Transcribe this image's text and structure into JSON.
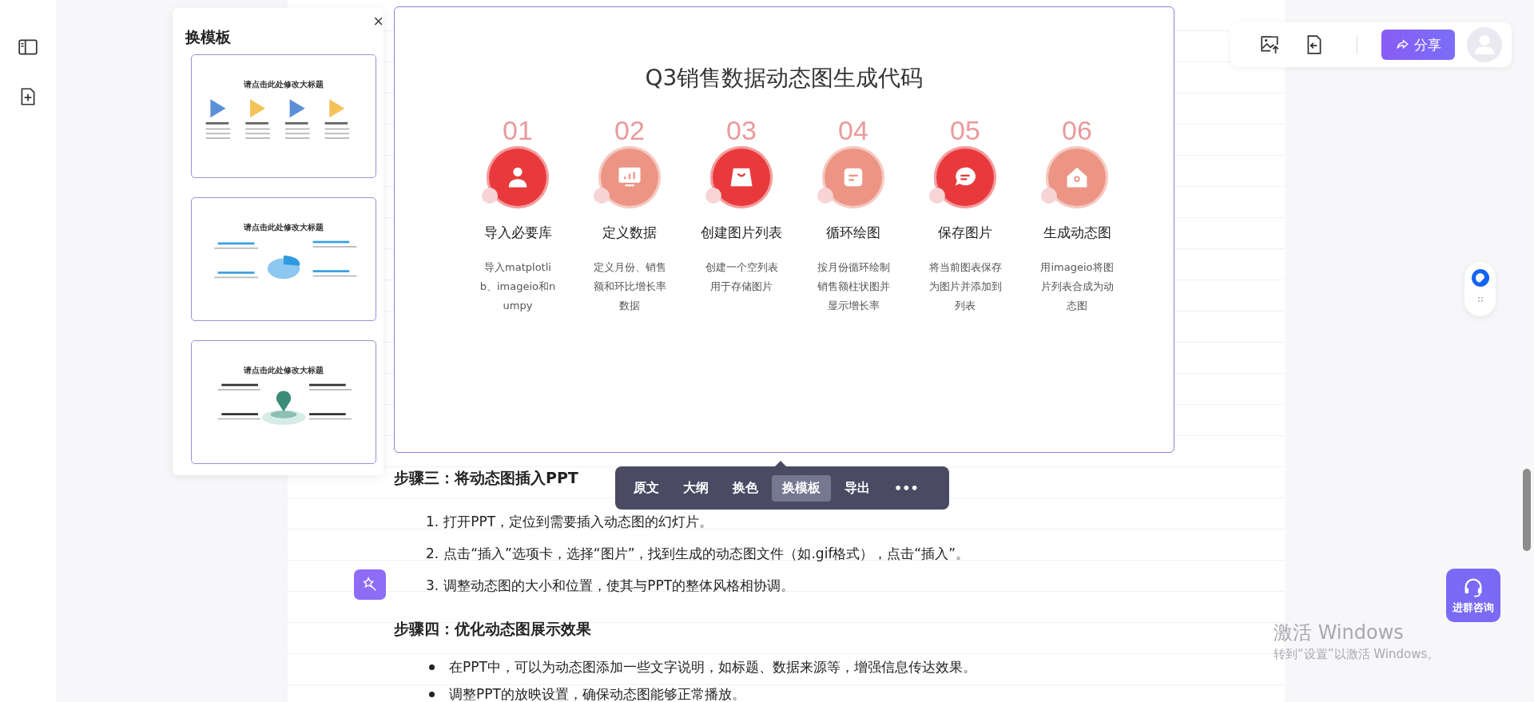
{
  "template_panel": {
    "title": "换模板",
    "close": "×",
    "templates": [
      {
        "kind": "arrows",
        "title": "请点击此处修改大标题",
        "selected": false
      },
      {
        "kind": "pie",
        "title": "请点击此处修改大标题",
        "selected": false
      },
      {
        "kind": "pin",
        "title": "请点击此处修改大标题",
        "selected": false
      }
    ]
  },
  "slide": {
    "title": "Q3销售数据动态图生成代码",
    "steps": [
      {
        "number": "01",
        "kind": "person",
        "color": "#e83a3c",
        "title": "导入必要库",
        "desc": "导入matplotlib、imageio和numpy"
      },
      {
        "number": "02",
        "kind": "chart",
        "color": "#ec9585",
        "title": "定义数据",
        "desc": "定义月份、销售额和环比增长率数据"
      },
      {
        "number": "03",
        "kind": "bag",
        "color": "#e83a3c",
        "title": "创建图片列表",
        "desc": "创建一个空列表用于存储图片"
      },
      {
        "number": "04",
        "kind": "note",
        "color": "#ec9585",
        "title": "循环绘图",
        "desc": "按月份循环绘制销售额柱状图并显示增长率"
      },
      {
        "number": "05",
        "kind": "chat",
        "color": "#e83a3c",
        "title": "保存图片",
        "desc": "将当前图表保存为图片并添加到列表"
      },
      {
        "number": "06",
        "kind": "house",
        "color": "#ec9585",
        "title": "生成动态图",
        "desc": "用imageio将图片列表合成为动态图"
      }
    ]
  },
  "slide_toolbar": {
    "items": [
      {
        "label": "原文",
        "selected": false
      },
      {
        "label": "大纲",
        "selected": false
      },
      {
        "label": "换色",
        "selected": false
      },
      {
        "label": "换模板",
        "selected": true
      },
      {
        "label": "导出",
        "selected": false
      }
    ],
    "more": "•••"
  },
  "sections": [
    {
      "heading": "步骤三：将动态图插入PPT",
      "kind": "ordered",
      "items": [
        {
          "marker": "1.",
          "text": "打开PPT，定位到需要插入动态图的幻灯片。"
        },
        {
          "marker": "2.",
          "text": "点击“插入”选项卡，选择“图片”，找到生成的动态图文件（如.gif格式），点击“插入”。"
        },
        {
          "marker": "3.",
          "text": "调整动态图的大小和位置，使其与PPT的整体风格相协调。"
        }
      ]
    },
    {
      "heading": "步骤四：优化动态图展示效果",
      "kind": "bullet",
      "items": [
        {
          "text": "在PPT中，可以为动态图添加一些文字说明，如标题、数据来源等，增强信息传达效果。"
        },
        {
          "text": "调整PPT的放映设置，确保动态图能够正常播放。"
        }
      ]
    }
  ],
  "top_actions": {
    "share": "分享"
  },
  "consult": {
    "label": "进群咨询"
  },
  "activation": {
    "title": "激活 Windows",
    "subtitle": "转到“设置”以激活 Windows。"
  }
}
